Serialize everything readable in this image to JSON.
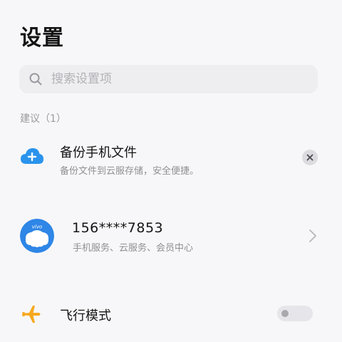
{
  "header": {
    "title": "设置"
  },
  "search": {
    "placeholder": "搜索设置项",
    "value": "",
    "icon": "search-icon"
  },
  "suggestions": {
    "header": "建议（1）",
    "items": [
      {
        "icon": "cloud-plus-icon",
        "title": "备份手机文件",
        "subtitle": "备份文件到云服存储，安全便捷。",
        "dismiss_icon": "close-icon"
      }
    ]
  },
  "account": {
    "avatar": "vivo-avatar",
    "number": "156****7853",
    "services": "手机服务、云服务、会员中心",
    "chevron": "chevron-right-icon"
  },
  "airplane_mode": {
    "icon": "airplane-icon",
    "label": "飞行模式",
    "enabled": false
  },
  "colors": {
    "cloud_blue": "#2b93ec",
    "avatar_blue": "#2e86e6",
    "airplane_orange": "#f7a81e",
    "background": "#f7f7f9"
  }
}
